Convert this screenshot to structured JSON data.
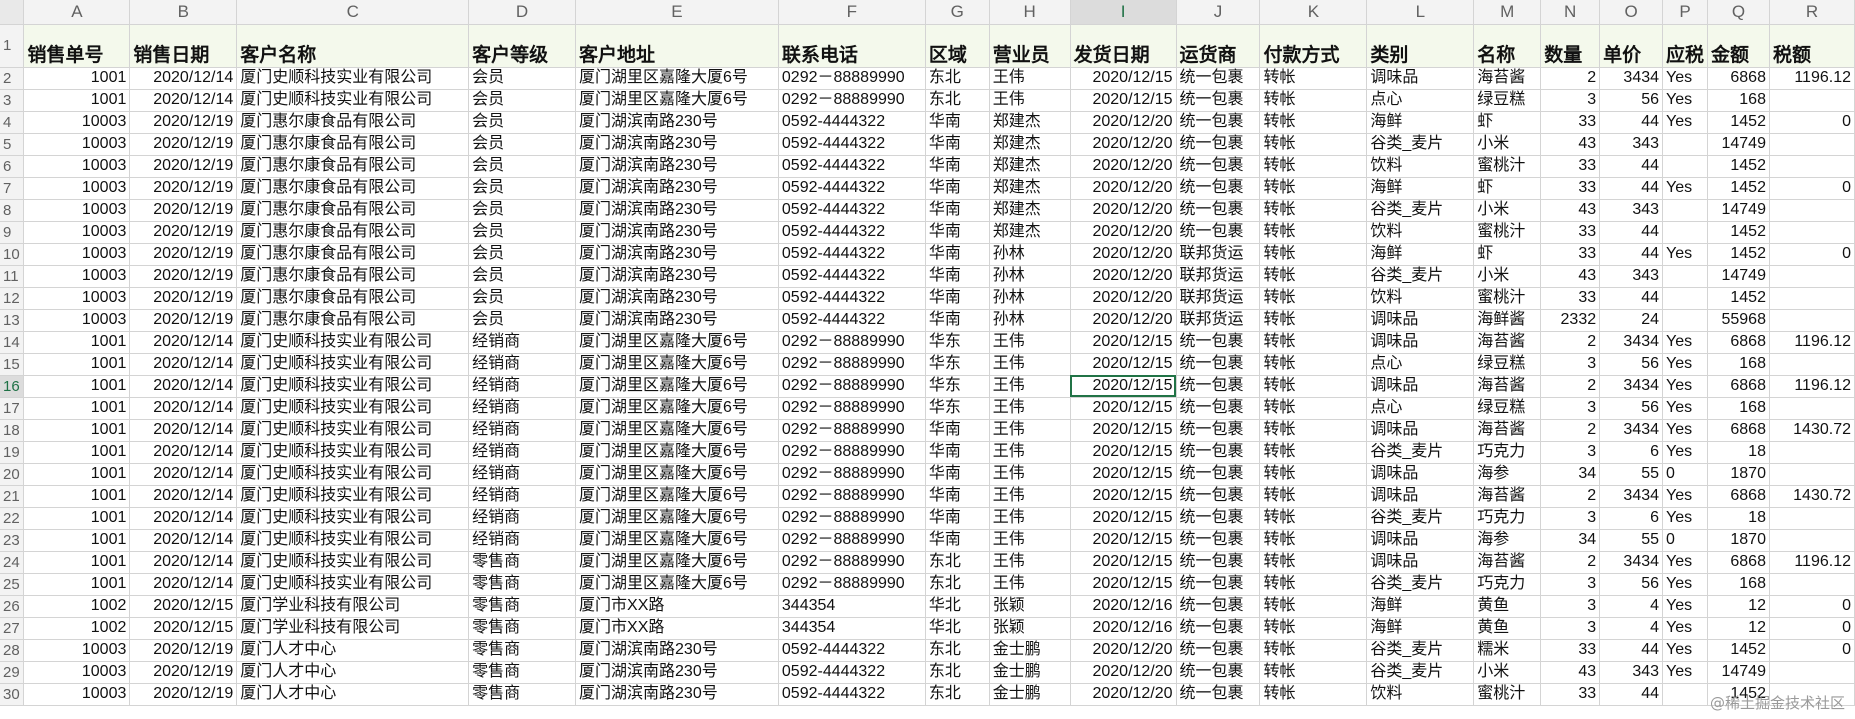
{
  "columns": [
    "A",
    "B",
    "C",
    "D",
    "E",
    "F",
    "G",
    "H",
    "I",
    "J",
    "K",
    "L",
    "M",
    "N",
    "O",
    "P",
    "Q",
    "R"
  ],
  "active_column": "I",
  "active_row": "16",
  "selected_cell": "I16",
  "header_row": {
    "row_number": "1",
    "cells": [
      "销售单号",
      "销售日期",
      "客户名称",
      "客户等级",
      "客户地址",
      "联系电话",
      "区域",
      "营业员",
      "发货日期",
      "运货商",
      "付款方式",
      "类别",
      "名称",
      "数量",
      "单价",
      "应税",
      "金额",
      "税额"
    ]
  },
  "rows": [
    {
      "n": "2",
      "cells": [
        "1001",
        "2020/12/14",
        "厦门史顺科技实业有限公司",
        "会员",
        "厦门湖里区嘉隆大厦6号",
        "0292－88889990",
        "东北",
        "王伟",
        "2020/12/15",
        "统一包裹",
        "转帐",
        "调味品",
        "海苔酱",
        "2",
        "3434",
        "Yes",
        "6868",
        "1196.12"
      ]
    },
    {
      "n": "3",
      "cells": [
        "1001",
        "2020/12/14",
        "厦门史顺科技实业有限公司",
        "会员",
        "厦门湖里区嘉隆大厦6号",
        "0292－88889990",
        "东北",
        "王伟",
        "2020/12/15",
        "统一包裹",
        "转帐",
        "点心",
        "绿豆糕",
        "3",
        "56",
        "Yes",
        "168",
        ""
      ]
    },
    {
      "n": "4",
      "cells": [
        "10003",
        "2020/12/19",
        "厦门惠尔康食品有限公司",
        "会员",
        "厦门湖滨南路230号",
        "0592-4444322",
        "华南",
        "郑建杰",
        "2020/12/20",
        "统一包裹",
        "转帐",
        "海鲜",
        "虾",
        "33",
        "44",
        "Yes",
        "1452",
        "0"
      ]
    },
    {
      "n": "5",
      "cells": [
        "10003",
        "2020/12/19",
        "厦门惠尔康食品有限公司",
        "会员",
        "厦门湖滨南路230号",
        "0592-4444322",
        "华南",
        "郑建杰",
        "2020/12/20",
        "统一包裹",
        "转帐",
        "谷类_麦片",
        "小米",
        "43",
        "343",
        "",
        "14749",
        ""
      ]
    },
    {
      "n": "6",
      "cells": [
        "10003",
        "2020/12/19",
        "厦门惠尔康食品有限公司",
        "会员",
        "厦门湖滨南路230号",
        "0592-4444322",
        "华南",
        "郑建杰",
        "2020/12/20",
        "统一包裹",
        "转帐",
        "饮料",
        "蜜桃汁",
        "33",
        "44",
        "",
        "1452",
        ""
      ]
    },
    {
      "n": "7",
      "cells": [
        "10003",
        "2020/12/19",
        "厦门惠尔康食品有限公司",
        "会员",
        "厦门湖滨南路230号",
        "0592-4444322",
        "华南",
        "郑建杰",
        "2020/12/20",
        "统一包裹",
        "转帐",
        "海鲜",
        "虾",
        "33",
        "44",
        "Yes",
        "1452",
        "0"
      ]
    },
    {
      "n": "8",
      "cells": [
        "10003",
        "2020/12/19",
        "厦门惠尔康食品有限公司",
        "会员",
        "厦门湖滨南路230号",
        "0592-4444322",
        "华南",
        "郑建杰",
        "2020/12/20",
        "统一包裹",
        "转帐",
        "谷类_麦片",
        "小米",
        "43",
        "343",
        "",
        "14749",
        ""
      ]
    },
    {
      "n": "9",
      "cells": [
        "10003",
        "2020/12/19",
        "厦门惠尔康食品有限公司",
        "会员",
        "厦门湖滨南路230号",
        "0592-4444322",
        "华南",
        "郑建杰",
        "2020/12/20",
        "统一包裹",
        "转帐",
        "饮料",
        "蜜桃汁",
        "33",
        "44",
        "",
        "1452",
        ""
      ]
    },
    {
      "n": "10",
      "cells": [
        "10003",
        "2020/12/19",
        "厦门惠尔康食品有限公司",
        "会员",
        "厦门湖滨南路230号",
        "0592-4444322",
        "华南",
        "孙林",
        "2020/12/20",
        "联邦货运",
        "转帐",
        "海鲜",
        "虾",
        "33",
        "44",
        "Yes",
        "1452",
        "0"
      ]
    },
    {
      "n": "11",
      "cells": [
        "10003",
        "2020/12/19",
        "厦门惠尔康食品有限公司",
        "会员",
        "厦门湖滨南路230号",
        "0592-4444322",
        "华南",
        "孙林",
        "2020/12/20",
        "联邦货运",
        "转帐",
        "谷类_麦片",
        "小米",
        "43",
        "343",
        "",
        "14749",
        ""
      ]
    },
    {
      "n": "12",
      "cells": [
        "10003",
        "2020/12/19",
        "厦门惠尔康食品有限公司",
        "会员",
        "厦门湖滨南路230号",
        "0592-4444322",
        "华南",
        "孙林",
        "2020/12/20",
        "联邦货运",
        "转帐",
        "饮料",
        "蜜桃汁",
        "33",
        "44",
        "",
        "1452",
        ""
      ]
    },
    {
      "n": "13",
      "cells": [
        "10003",
        "2020/12/19",
        "厦门惠尔康食品有限公司",
        "会员",
        "厦门湖滨南路230号",
        "0592-4444322",
        "华南",
        "孙林",
        "2020/12/20",
        "联邦货运",
        "转帐",
        "调味品",
        "海鲜酱",
        "2332",
        "24",
        "",
        "55968",
        ""
      ]
    },
    {
      "n": "14",
      "cells": [
        "1001",
        "2020/12/14",
        "厦门史顺科技实业有限公司",
        "经销商",
        "厦门湖里区嘉隆大厦6号",
        "0292－88889990",
        "华东",
        "王伟",
        "2020/12/15",
        "统一包裹",
        "转帐",
        "调味品",
        "海苔酱",
        "2",
        "3434",
        "Yes",
        "6868",
        "1196.12"
      ]
    },
    {
      "n": "15",
      "cells": [
        "1001",
        "2020/12/14",
        "厦门史顺科技实业有限公司",
        "经销商",
        "厦门湖里区嘉隆大厦6号",
        "0292－88889990",
        "华东",
        "王伟",
        "2020/12/15",
        "统一包裹",
        "转帐",
        "点心",
        "绿豆糕",
        "3",
        "56",
        "Yes",
        "168",
        ""
      ]
    },
    {
      "n": "16",
      "cells": [
        "1001",
        "2020/12/14",
        "厦门史顺科技实业有限公司",
        "经销商",
        "厦门湖里区嘉隆大厦6号",
        "0292－88889990",
        "华东",
        "王伟",
        "2020/12/15",
        "统一包裹",
        "转帐",
        "调味品",
        "海苔酱",
        "2",
        "3434",
        "Yes",
        "6868",
        "1196.12"
      ]
    },
    {
      "n": "17",
      "cells": [
        "1001",
        "2020/12/14",
        "厦门史顺科技实业有限公司",
        "经销商",
        "厦门湖里区嘉隆大厦6号",
        "0292－88889990",
        "华东",
        "王伟",
        "2020/12/15",
        "统一包裹",
        "转帐",
        "点心",
        "绿豆糕",
        "3",
        "56",
        "Yes",
        "168",
        ""
      ]
    },
    {
      "n": "18",
      "cells": [
        "1001",
        "2020/12/14",
        "厦门史顺科技实业有限公司",
        "经销商",
        "厦门湖里区嘉隆大厦6号",
        "0292－88889990",
        "华南",
        "王伟",
        "2020/12/15",
        "统一包裹",
        "转帐",
        "调味品",
        "海苔酱",
        "2",
        "3434",
        "Yes",
        "6868",
        "1430.72"
      ]
    },
    {
      "n": "19",
      "cells": [
        "1001",
        "2020/12/14",
        "厦门史顺科技实业有限公司",
        "经销商",
        "厦门湖里区嘉隆大厦6号",
        "0292－88889990",
        "华南",
        "王伟",
        "2020/12/15",
        "统一包裹",
        "转帐",
        "谷类_麦片",
        "巧克力",
        "3",
        "6",
        "Yes",
        "18",
        ""
      ]
    },
    {
      "n": "20",
      "cells": [
        "1001",
        "2020/12/14",
        "厦门史顺科技实业有限公司",
        "经销商",
        "厦门湖里区嘉隆大厦6号",
        "0292－88889990",
        "华南",
        "王伟",
        "2020/12/15",
        "统一包裹",
        "转帐",
        "调味品",
        "海参",
        "34",
        "55",
        "0",
        "1870",
        ""
      ]
    },
    {
      "n": "21",
      "cells": [
        "1001",
        "2020/12/14",
        "厦门史顺科技实业有限公司",
        "经销商",
        "厦门湖里区嘉隆大厦6号",
        "0292－88889990",
        "华南",
        "王伟",
        "2020/12/15",
        "统一包裹",
        "转帐",
        "调味品",
        "海苔酱",
        "2",
        "3434",
        "Yes",
        "6868",
        "1430.72"
      ]
    },
    {
      "n": "22",
      "cells": [
        "1001",
        "2020/12/14",
        "厦门史顺科技实业有限公司",
        "经销商",
        "厦门湖里区嘉隆大厦6号",
        "0292－88889990",
        "华南",
        "王伟",
        "2020/12/15",
        "统一包裹",
        "转帐",
        "谷类_麦片",
        "巧克力",
        "3",
        "6",
        "Yes",
        "18",
        ""
      ]
    },
    {
      "n": "23",
      "cells": [
        "1001",
        "2020/12/14",
        "厦门史顺科技实业有限公司",
        "经销商",
        "厦门湖里区嘉隆大厦6号",
        "0292－88889990",
        "华南",
        "王伟",
        "2020/12/15",
        "统一包裹",
        "转帐",
        "调味品",
        "海参",
        "34",
        "55",
        "0",
        "1870",
        ""
      ]
    },
    {
      "n": "24",
      "cells": [
        "1001",
        "2020/12/14",
        "厦门史顺科技实业有限公司",
        "零售商",
        "厦门湖里区嘉隆大厦6号",
        "0292－88889990",
        "东北",
        "王伟",
        "2020/12/15",
        "统一包裹",
        "转帐",
        "调味品",
        "海苔酱",
        "2",
        "3434",
        "Yes",
        "6868",
        "1196.12"
      ]
    },
    {
      "n": "25",
      "cells": [
        "1001",
        "2020/12/14",
        "厦门史顺科技实业有限公司",
        "零售商",
        "厦门湖里区嘉隆大厦6号",
        "0292－88889990",
        "东北",
        "王伟",
        "2020/12/15",
        "统一包裹",
        "转帐",
        "谷类_麦片",
        "巧克力",
        "3",
        "56",
        "Yes",
        "168",
        ""
      ]
    },
    {
      "n": "26",
      "cells": [
        "1002",
        "2020/12/15",
        "厦门学业科技有限公司",
        "零售商",
        "厦门市XX路",
        "344354",
        "华北",
        "张颖",
        "2020/12/16",
        "统一包裹",
        "转帐",
        "海鲜",
        "黄鱼",
        "3",
        "4",
        "Yes",
        "12",
        "0"
      ]
    },
    {
      "n": "27",
      "cells": [
        "1002",
        "2020/12/15",
        "厦门学业科技有限公司",
        "零售商",
        "厦门市XX路",
        "344354",
        "华北",
        "张颖",
        "2020/12/16",
        "统一包裹",
        "转帐",
        "海鲜",
        "黄鱼",
        "3",
        "4",
        "Yes",
        "12",
        "0"
      ]
    },
    {
      "n": "28",
      "cells": [
        "10003",
        "2020/12/19",
        "厦门人才中心",
        "零售商",
        "厦门湖滨南路230号",
        "0592-4444322",
        "东北",
        "金士鹏",
        "2020/12/20",
        "统一包裹",
        "转帐",
        "谷类_麦片",
        "糯米",
        "33",
        "44",
        "Yes",
        "1452",
        "0"
      ]
    },
    {
      "n": "29",
      "cells": [
        "10003",
        "2020/12/19",
        "厦门人才中心",
        "零售商",
        "厦门湖滨南路230号",
        "0592-4444322",
        "东北",
        "金士鹏",
        "2020/12/20",
        "统一包裹",
        "转帐",
        "谷类_麦片",
        "小米",
        "43",
        "343",
        "Yes",
        "14749",
        ""
      ]
    },
    {
      "n": "30",
      "cells": [
        "10003",
        "2020/12/19",
        "厦门人才中心",
        "零售商",
        "厦门湖滨南路230号",
        "0592-4444322",
        "东北",
        "金士鹏",
        "2020/12/20",
        "统一包裹",
        "转帐",
        "饮料",
        "蜜桃汁",
        "33",
        "44",
        "",
        "1452",
        ""
      ]
    }
  ],
  "watermark": "@稀土掘金技术社区"
}
